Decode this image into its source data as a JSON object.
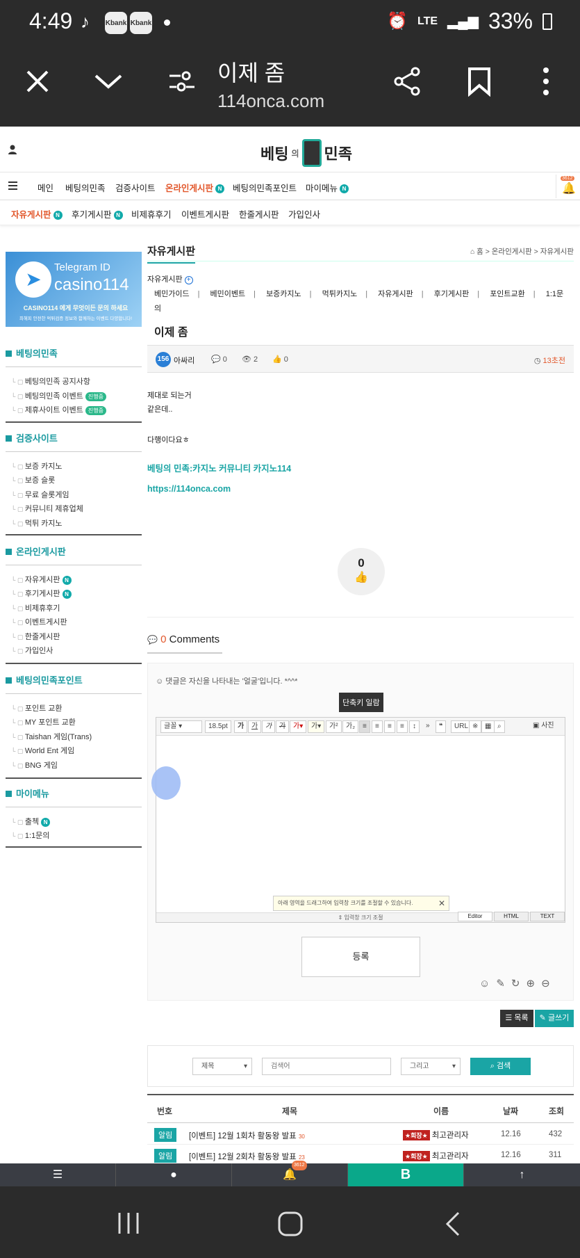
{
  "status": {
    "time": "4:49",
    "app1": "Kbank",
    "app2": "Kbank",
    "network": "LTE",
    "battery": "33%"
  },
  "browser": {
    "title": "이제 좀",
    "url": "114onca.com"
  },
  "site": {
    "logo_left": "베팅",
    "logo_small": "의",
    "logo_right": "민족"
  },
  "gnb": [
    "메인",
    "베팅의민족",
    "검증사이트",
    "온라인게시판",
    "베팅의민족포인트",
    "마이메뉴"
  ],
  "bell_count": "3612",
  "snb": [
    "자유게시판",
    "후기게시판",
    "비제휴후기",
    "이벤트게시판",
    "한줄게시판",
    "가입인사"
  ],
  "banner": {
    "line1": "Telegram ID",
    "line2": "casino114",
    "line3": "CASINO114 에게 무엇이든 문의 하세요",
    "line4": "최해피 안전한 먹튀검증 정보와 함께하는 이벤트 다양합니다!"
  },
  "sidebar": [
    {
      "title": "베팅의민족",
      "items": [
        {
          "label": "베팅의민족 공지사항"
        },
        {
          "label": "베팅의민족 이벤트",
          "badge": "진행중"
        },
        {
          "label": "제휴사이트 이벤트",
          "badge": "진행중"
        }
      ]
    },
    {
      "title": "검증사이트",
      "items": [
        {
          "label": "보증 카지노"
        },
        {
          "label": "보증 슬롯"
        },
        {
          "label": "무료 슬롯게임"
        },
        {
          "label": "커뮤니티 제휴업체"
        },
        {
          "label": "먹튀 카지노"
        }
      ]
    },
    {
      "title": "온라인게시판",
      "items": [
        {
          "label": "자유게시판",
          "n": "N"
        },
        {
          "label": "후기게시판",
          "n": "N"
        },
        {
          "label": "비제휴후기"
        },
        {
          "label": "이벤트게시판"
        },
        {
          "label": "한줄게시판"
        },
        {
          "label": "가입인사"
        }
      ]
    },
    {
      "title": "베팅의민족포인트",
      "items": [
        {
          "label": "포인트 교환"
        },
        {
          "label": "MY 포인트 교환"
        },
        {
          "label": "Taishan 게임(Trans)"
        },
        {
          "label": "World Ent 게임"
        },
        {
          "label": "BNG 게임"
        }
      ]
    },
    {
      "title": "마이메뉴",
      "items": [
        {
          "label": "출첵",
          "n": "N"
        },
        {
          "label": "1:1문의"
        }
      ]
    }
  ],
  "board": {
    "title": "자유게시판",
    "breadcrumb": "홈 > 온라인게시판 > 자유게시판",
    "category_label": "자유게시판",
    "categories": [
      "베민가이드",
      "베민이벤트",
      "보증카지노",
      "먹튀카지노",
      "자유게시판",
      "후기게시판",
      "포인트교환",
      "1:1문의"
    ]
  },
  "post": {
    "title": "이제 좀",
    "level": "156",
    "author": "아싸리",
    "comments": "0",
    "views": "2",
    "likes": "0",
    "time": "13초전",
    "body": [
      "제대로 되는거",
      "같은데..",
      "",
      "다행이다요ㅎ"
    ],
    "link1": "베팅의 민족:카지노 커뮤니티 카지노114",
    "link2": "https://114onca.com",
    "like_count": "0"
  },
  "comments": {
    "count": "0",
    "label": "Comments",
    "hint": "댓글은 자신을 나타내는 '얼굴'입니다. *^^*",
    "tooltip": "단축키 일람",
    "font": "글꼴",
    "size": "18.5pt",
    "photo": "사진",
    "resize_hint": "아래 영역을 드래그하여 입력창 크기를 조절할 수 있습니다.",
    "resize": "입력창 크기 조절",
    "tabs": [
      "Editor",
      "HTML",
      "TEXT"
    ],
    "submit": "등록"
  },
  "buttons": {
    "list": "목록",
    "write": "글쓰기"
  },
  "search": {
    "field": "제목",
    "placeholder": "검색어",
    "op": "그리고",
    "button": "검색"
  },
  "table": {
    "headers": [
      "번호",
      "제목",
      "이름",
      "날짜",
      "조회"
    ],
    "rows": [
      {
        "badge": "알림",
        "title": "[이벤트] 12월 1회차 활동왕 발표",
        "count": "30",
        "rank": "★회장★",
        "name": "최고관리자",
        "date": "12.16",
        "views": "432"
      },
      {
        "badge": "알림",
        "title": "[이벤트] 12월 2회차 활동왕 발표",
        "count": "23",
        "rank": "★회장★",
        "name": "최고관리자",
        "date": "12.16",
        "views": "311"
      }
    ]
  },
  "bottom_nav_bell": "3612"
}
